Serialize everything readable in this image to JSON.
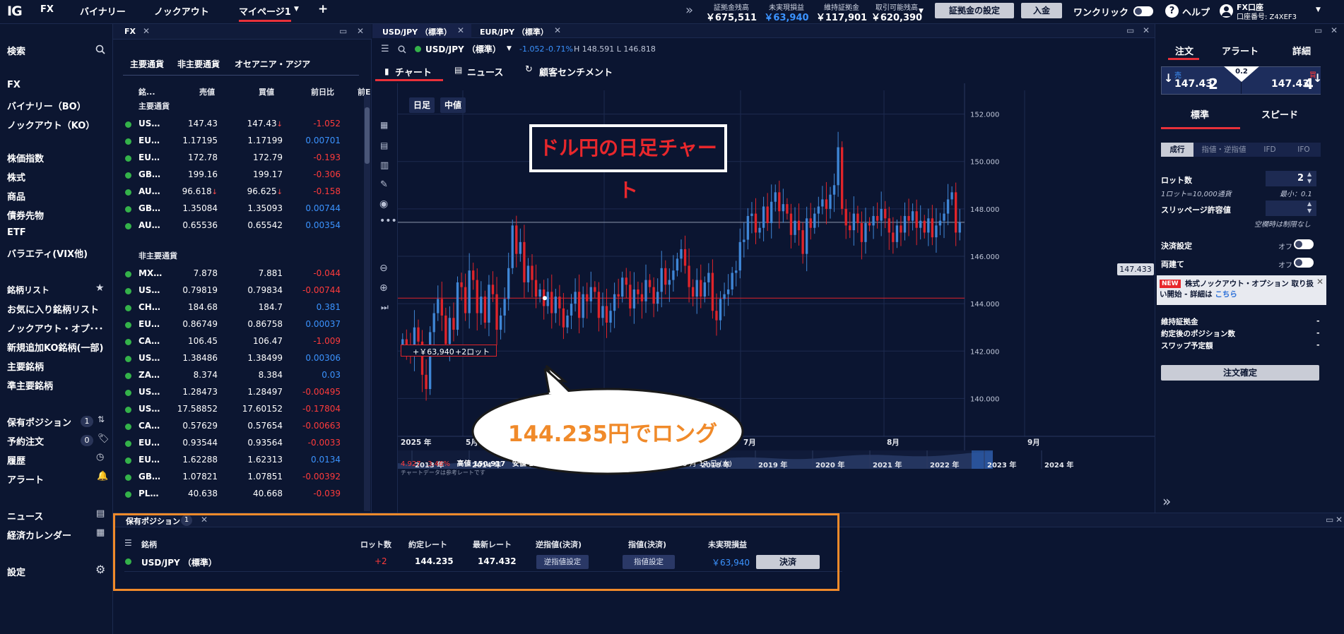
{
  "topbar": {
    "logo": "IG",
    "tabs": [
      {
        "label": "FX"
      },
      {
        "label": "バイナリー"
      },
      {
        "label": "ノックアウト"
      },
      {
        "label": "マイページ1"
      }
    ],
    "add_tab": "+",
    "collapse": "»",
    "account": [
      {
        "label": "証拠金残高",
        "value": "￥675,511"
      },
      {
        "label": "未実現損益",
        "value": "￥63,940"
      },
      {
        "label": "維持証拠金",
        "value": "￥117,901"
      },
      {
        "label": "取引可能残高",
        "value": "￥620,390"
      }
    ],
    "margin_settings": "証拠金の設定",
    "deposit": "入金",
    "one_click": "ワンクリック",
    "help": "ヘルプ",
    "account_name": "FX口座",
    "account_number": "口座番号: Z4XEF3"
  },
  "sidebar": {
    "search": "検索",
    "main_items": [
      "FX",
      "バイナリー（BO）",
      "ノックアウト（KO）"
    ],
    "product_items": [
      "株価指数",
      "株式",
      "商品",
      "債券先物",
      "ETF",
      "バラエティ(VIX他)"
    ],
    "watchlist_header": "銘柄リスト",
    "watchlist_items": [
      "お気に入り銘柄リスト",
      "ノックアウト・オプ･･･",
      "新規追加KO銘柄(一部)",
      "主要銘柄",
      "準主要銘柄"
    ],
    "positions": {
      "label": "保有ポジション",
      "count": "1"
    },
    "orders": {
      "label": "予約注文",
      "count": "0"
    },
    "history": "履歴",
    "alerts": "アラート",
    "news": "ニュース",
    "calendar": "経済カレンダー",
    "settings": "設定"
  },
  "fx_panel": {
    "tab": "FX",
    "categories": [
      "主要通貨",
      "非主要通貨",
      "オセアニア・アジア"
    ],
    "columns": [
      "銘...",
      "売値",
      "買値",
      "前日比",
      "前E"
    ],
    "group_major": "主要通貨",
    "group_minor": "非主要通貨",
    "major_rows": [
      {
        "name": "US…",
        "bid": "147.43",
        "ask": "147.43",
        "ask_arrow": "↓",
        "change": "-1.052",
        "dir": "neg"
      },
      {
        "name": "EU…",
        "bid": "1.17195",
        "ask": "1.17199",
        "change": "0.00701",
        "dir": "pos"
      },
      {
        "name": "EU…",
        "bid": "172.78",
        "ask": "172.79",
        "change": "-0.193",
        "dir": "neg"
      },
      {
        "name": "GB…",
        "bid": "199.16",
        "ask": "199.17",
        "change": "-0.306",
        "dir": "neg"
      },
      {
        "name": "AU…",
        "bid": "96.618",
        "bid_arrow": "↓",
        "ask": "96.625",
        "ask_arrow": "↓",
        "change": "-0.158",
        "dir": "neg"
      },
      {
        "name": "GB…",
        "bid": "1.35084",
        "ask": "1.35093",
        "change": "0.00744",
        "dir": "pos"
      },
      {
        "name": "AU…",
        "bid": "0.65536",
        "ask": "0.65542",
        "change": "0.00354",
        "dir": "pos"
      }
    ],
    "minor_rows": [
      {
        "name": "MX…",
        "bid": "7.878",
        "ask": "7.881",
        "change": "-0.044",
        "dir": "neg"
      },
      {
        "name": "US…",
        "bid": "0.79819",
        "ask": "0.79834",
        "change": "-0.00744",
        "dir": "neg"
      },
      {
        "name": "CH…",
        "bid": "184.68",
        "ask": "184.7",
        "change": "0.381",
        "dir": "pos"
      },
      {
        "name": "EU…",
        "bid": "0.86749",
        "ask": "0.86758",
        "change": "0.00037",
        "dir": "pos"
      },
      {
        "name": "CA…",
        "bid": "106.45",
        "ask": "106.47",
        "change": "-1.009",
        "dir": "neg"
      },
      {
        "name": "US…",
        "bid": "1.38486",
        "ask": "1.38499",
        "change": "0.00306",
        "dir": "pos"
      },
      {
        "name": "ZA…",
        "bid": "8.374",
        "ask": "8.384",
        "change": "0.03",
        "dir": "pos"
      },
      {
        "name": "US…",
        "bid": "1.28473",
        "ask": "1.28497",
        "change": "-0.00495",
        "dir": "neg"
      },
      {
        "name": "US…",
        "bid": "17.58852",
        "ask": "17.60152",
        "change": "-0.17804",
        "dir": "neg"
      },
      {
        "name": "CA…",
        "bid": "0.57629",
        "ask": "0.57654",
        "change": "-0.00663",
        "dir": "neg"
      },
      {
        "name": "EU…",
        "bid": "0.93544",
        "ask": "0.93564",
        "change": "-0.0033",
        "dir": "neg"
      },
      {
        "name": "EU…",
        "bid": "1.62288",
        "ask": "1.62313",
        "change": "0.0134",
        "dir": "pos"
      },
      {
        "name": "GB…",
        "bid": "1.07821",
        "ask": "1.07851",
        "change": "-0.00392",
        "dir": "neg"
      },
      {
        "name": "PL…",
        "bid": "40.638",
        "ask": "40.668",
        "change": "-0.039",
        "dir": "neg"
      }
    ]
  },
  "chart_panel": {
    "tabs": [
      "USD/JPY （標準）",
      "EUR/JPY （標準）"
    ],
    "instrument": "USD/JPY （標準）",
    "change_abs": "-1.052",
    "change_pct": "-0.71%",
    "high_low": "H 148.591  L 146.818",
    "subtabs": [
      "チャート",
      "ニュース",
      "顧客センチメント"
    ],
    "timeframe": "日足",
    "price_type": "中値",
    "annotation_title": "ドル円の日足チャート",
    "annotation_callout": "144.235円でロング",
    "position_label_pl": "+￥63,940",
    "position_label_lots": "+2ロット",
    "current_price": "147.433",
    "stats": {
      "change": "4.927",
      "pct": "3.46%",
      "high_label": "高値",
      "high": "150.917",
      "low_label": "安値",
      "low": "139.887",
      "range": "2025 年 4 月 17 日 (木) - 2025 年 9 月 17 日 (水)"
    },
    "note": "チャートデータは参考レートです",
    "x_labels": [
      "2025 年",
      "5月",
      "6月",
      "7月",
      "8月",
      "9月"
    ],
    "navigator_years": [
      "2013 年",
      "2014 年",
      "2015 年",
      "2016 年",
      "2017 年",
      "2018 年",
      "2019 年",
      "2020 年",
      "2021 年",
      "2022 年",
      "2023 年",
      "2024 年"
    ],
    "colors": {
      "up": "#3f86d6",
      "down": "#e0242a",
      "annotation_red": "#e8272c",
      "annotation_orange": "#f08a2a"
    }
  },
  "chart_data": {
    "type": "candlestick",
    "title": "",
    "ylim": [
      139.0,
      153.0
    ],
    "y_ticks": [
      "152.000",
      "150.000",
      "148.000",
      "146.000",
      "144.000",
      "142.000",
      "140.000"
    ],
    "x_ticks": [
      "2025 年",
      "5月",
      "6月",
      "7月",
      "8月",
      "9月"
    ],
    "entry_price": 144.235,
    "last_price": 147.433,
    "high": 150.917,
    "low": 139.887,
    "closes": [
      142.5,
      142.2,
      141.8,
      143.0,
      142.4,
      141.0,
      140.4,
      142.8,
      143.6,
      144.2,
      143.5,
      142.3,
      143.4,
      142.9,
      144.9,
      144.7,
      143.6,
      145.4,
      145.0,
      143.6,
      144.3,
      143.2,
      144.8,
      144.4,
      142.9,
      143.5,
      144.2,
      145.5,
      147.3,
      146.1,
      146.6,
      144.9,
      145.6,
      145.0,
      144.3,
      144.6,
      143.9,
      144.5,
      143.6,
      144.3,
      143.8,
      143.0,
      143.5,
      144.0,
      144.5,
      143.4,
      144.4,
      144.1,
      144.7,
      144.5,
      143.4,
      143.9,
      143.2,
      143.7,
      144.4,
      144.3,
      145.1,
      144.8,
      143.8,
      144.6,
      144.4,
      144.1,
      145.0,
      144.7,
      144.0,
      144.5,
      145.5,
      144.8,
      145.0,
      145.4,
      145.9,
      146.3,
      145.6,
      144.7,
      144.3,
      145.0,
      144.3,
      144.9,
      145.3,
      143.7,
      143.3,
      144.2,
      144.4,
      144.6,
      145.3,
      145.4,
      146.6,
      146.7,
      147.7,
      147.8,
      147.0,
      147.2,
      148.1,
      147.4,
      148.3,
      148.7,
      147.9,
      148.2,
      147.8,
      146.9,
      147.5,
      147.1,
      146.1,
      147.6,
      147.2,
      147.8,
      148.1,
      148.4,
      148.0,
      148.6,
      149.0,
      150.6,
      148.0,
      147.3,
      147.1,
      147.8,
      147.4,
      146.6,
      147.4,
      147.3,
      147.7,
      147.5,
      148.0,
      147.6,
      147.0,
      146.6,
      147.3,
      147.0,
      147.7,
      147.5,
      147.9,
      147.2,
      147.5,
      147.0,
      147.6,
      146.8,
      147.3,
      147.5,
      147.8,
      148.4,
      148.7,
      147.0,
      147.43
    ]
  },
  "order_panel": {
    "tabs": [
      "注文",
      "アラート",
      "詳細"
    ],
    "sell_label": "売",
    "buy_label": "買",
    "sell_big": "147.43",
    "sell_small": "2",
    "buy_big": "147.43",
    "buy_small": "4",
    "spread": "0.2",
    "mode_tabs": [
      "標準",
      "スピード"
    ],
    "order_types": [
      "成行",
      "指値・逆指値",
      "IFD",
      "IFO"
    ],
    "lot_label": "ロット数",
    "lot_value": "2",
    "lot_note": "1ロット=10,000通貨",
    "lot_min": "最小：0.1",
    "slippage_label": "スリッページ許容値",
    "slippage_note": "空欄時は制限なし",
    "settlement_label": "決済設定",
    "hedge_label": "両建て",
    "off": "オフ",
    "banner_new": "NEW",
    "banner_text": "株式ノックアウト・オプション 取り扱い開始 - 詳細は",
    "banner_link": "こちら",
    "info_labels": [
      "維持証拠金",
      "約定後のポジション数",
      "スワップ予定額"
    ],
    "info_values": [
      "-",
      "-",
      "-"
    ],
    "confirm": "注文確定"
  },
  "positions_panel": {
    "tab": "保有ポジション",
    "count": "1",
    "columns": [
      "銘柄",
      "ロット数",
      "約定レート",
      "最新レート",
      "逆指値(決済)",
      "指値(決済)",
      "未実現損益"
    ],
    "row": {
      "name": "USD/JPY （標準）",
      "lots": "+2",
      "entry": "144.235",
      "latest": "147.432",
      "stop_btn": "逆指値設定",
      "limit_btn": "指値設定",
      "pl": "￥63,940",
      "close_btn": "決済"
    }
  }
}
